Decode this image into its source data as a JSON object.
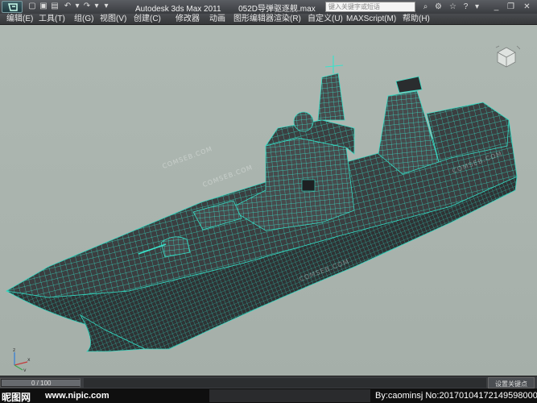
{
  "titlebar": {
    "app_name": "Autodesk 3ds Max  2011",
    "file_name": "052D导弹驱逐舰.max",
    "search_placeholder": "键入关键字或短语"
  },
  "menu": [
    {
      "label": "编辑(E)"
    },
    {
      "label": "工具(T)"
    },
    {
      "label": "组(G)"
    },
    {
      "label": "视图(V)"
    },
    {
      "label": "创建(C)"
    },
    {
      "label": "修改器"
    },
    {
      "label": "动画"
    },
    {
      "label": "图形编辑器"
    },
    {
      "label": "渲染(R)"
    },
    {
      "label": "自定义(U)"
    },
    {
      "label": "MAXScript(M)"
    },
    {
      "label": "帮助(H)"
    }
  ],
  "viewport": {
    "watermarks": [
      "COMSEB.COM",
      "COMSEB.COM",
      "COMSEB.COM",
      "COMSEB.COM"
    ],
    "axis_labels": {
      "x": "x",
      "y": "y",
      "z": "z"
    },
    "colors": {
      "background": "#aab4ae",
      "wireframe": "#39e0c8",
      "hull": "#3a3d3e"
    }
  },
  "timeline": {
    "frame_label": "0 / 100",
    "key_mode_label": "设置关键点"
  },
  "footer": {
    "site_logo": "昵图网",
    "site_url": "www.nipic.com",
    "author_line": "By:caominsj No:20170104172149598000"
  }
}
